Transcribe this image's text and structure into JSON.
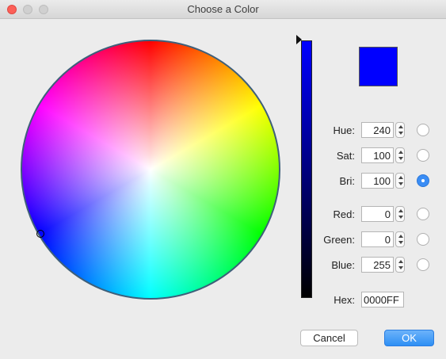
{
  "window": {
    "title": "Choose a Color"
  },
  "preview": {
    "color": "#0000FF"
  },
  "colors": {
    "accent": "#3a8df5"
  },
  "fields": {
    "hue": {
      "label": "Hue:",
      "value": "240",
      "selected": false
    },
    "sat": {
      "label": "Sat:",
      "value": "100",
      "selected": false
    },
    "bri": {
      "label": "Bri:",
      "value": "100",
      "selected": true
    },
    "red": {
      "label": "Red:",
      "value": "0",
      "selected": false
    },
    "green": {
      "label": "Green:",
      "value": "0",
      "selected": false
    },
    "blue": {
      "label": "Blue:",
      "value": "255",
      "selected": false
    }
  },
  "hex": {
    "label": "Hex:",
    "value": "0000FF"
  },
  "buttons": {
    "cancel": "Cancel",
    "ok": "OK"
  },
  "icons": {
    "close": "close-button",
    "minimize": "minimize-button",
    "zoom": "zoom-button",
    "brightness_pointer": "triangle-pointer-icon",
    "stepper": "up-down-stepper-icon"
  }
}
